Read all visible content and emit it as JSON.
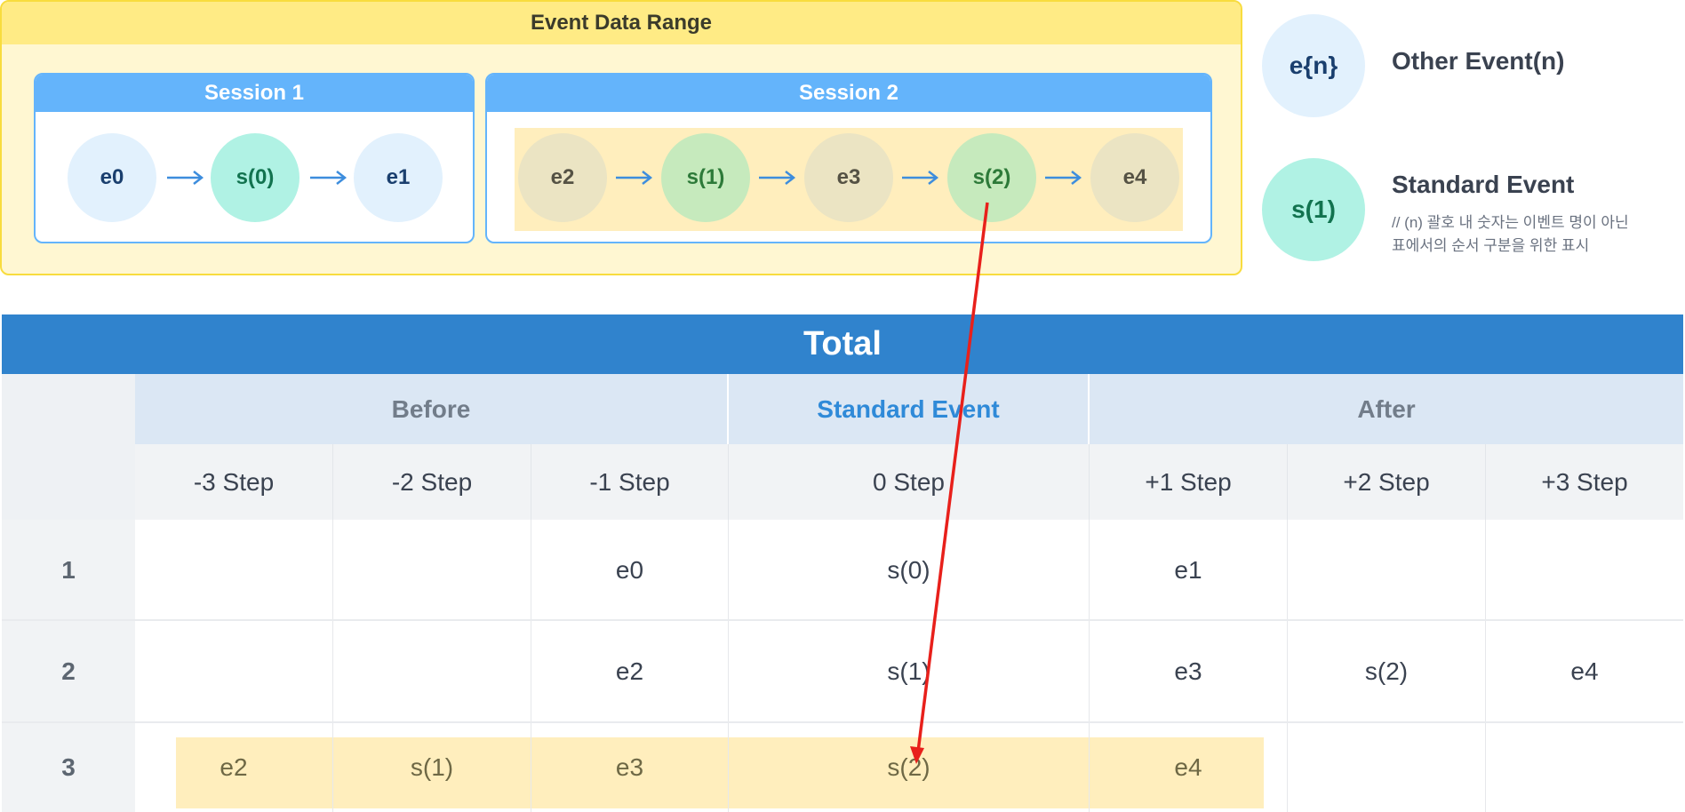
{
  "event_range": {
    "title": "Event Data Range",
    "session1": {
      "title": "Session 1",
      "nodes": [
        "e0",
        "s(0)",
        "e1"
      ]
    },
    "session2": {
      "title": "Session 2",
      "nodes": [
        "e2",
        "s(1)",
        "e3",
        "s(2)",
        "e4"
      ]
    }
  },
  "legend": {
    "other": {
      "symbol": "e{n}",
      "label": "Other Event(n)"
    },
    "standard": {
      "symbol": "s(1)",
      "label": "Standard Event",
      "note_line1": "// (n) 괄호 내 숫자는 이벤트 명이 아닌",
      "note_line2": "표에서의 순서 구분을 위한 표시"
    }
  },
  "table": {
    "title": "Total",
    "groups": {
      "before": "Before",
      "standard": "Standard Event",
      "after": "After"
    },
    "steps": [
      "-3 Step",
      "-2 Step",
      "-1 Step",
      "0 Step",
      "+1 Step",
      "+2 Step",
      "+3 Step"
    ],
    "rows": [
      {
        "label": "1",
        "cells": [
          "",
          "",
          "e0",
          "s(0)",
          "e1",
          "",
          ""
        ]
      },
      {
        "label": "2",
        "cells": [
          "",
          "",
          "e2",
          "s(1)",
          "e3",
          "s(2)",
          "e4"
        ]
      },
      {
        "label": "3",
        "cells": [
          "e2",
          "s(1)",
          "e3",
          "s(2)",
          "e4",
          "",
          ""
        ]
      }
    ]
  },
  "colors": {
    "accent_blue": "#3083cd",
    "session_blue": "#64b4fb",
    "range_yellow": "#f8dc3e",
    "highlight": "#ffeebd",
    "arrow_red": "#e8201b"
  }
}
